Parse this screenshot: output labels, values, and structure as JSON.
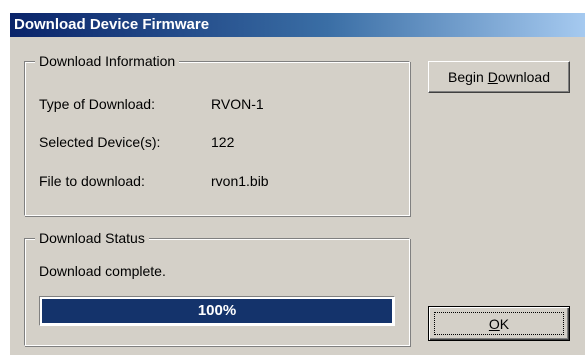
{
  "window": {
    "title": "Download Device Firmware"
  },
  "download_info": {
    "legend": "Download Information",
    "rows": [
      {
        "label": "Type of Download:",
        "value": "RVON-1"
      },
      {
        "label": "Selected Device(s):",
        "value": "122"
      },
      {
        "label": "File to download:",
        "value": "rvon1.bib"
      }
    ]
  },
  "download_status": {
    "legend": "Download Status",
    "message": "Download complete.",
    "progress_percent": 100,
    "progress_label": "100%"
  },
  "buttons": {
    "begin_download": {
      "prefix": "Begin ",
      "mnemonic": "D",
      "suffix": "ownload"
    },
    "ok": {
      "mnemonic": "O",
      "suffix": "K"
    }
  },
  "colors": {
    "titlebar_start": "#0a246a",
    "titlebar_end": "#a6caf0",
    "dialog_face": "#d4d0c8",
    "progress_fill": "#14336b"
  }
}
